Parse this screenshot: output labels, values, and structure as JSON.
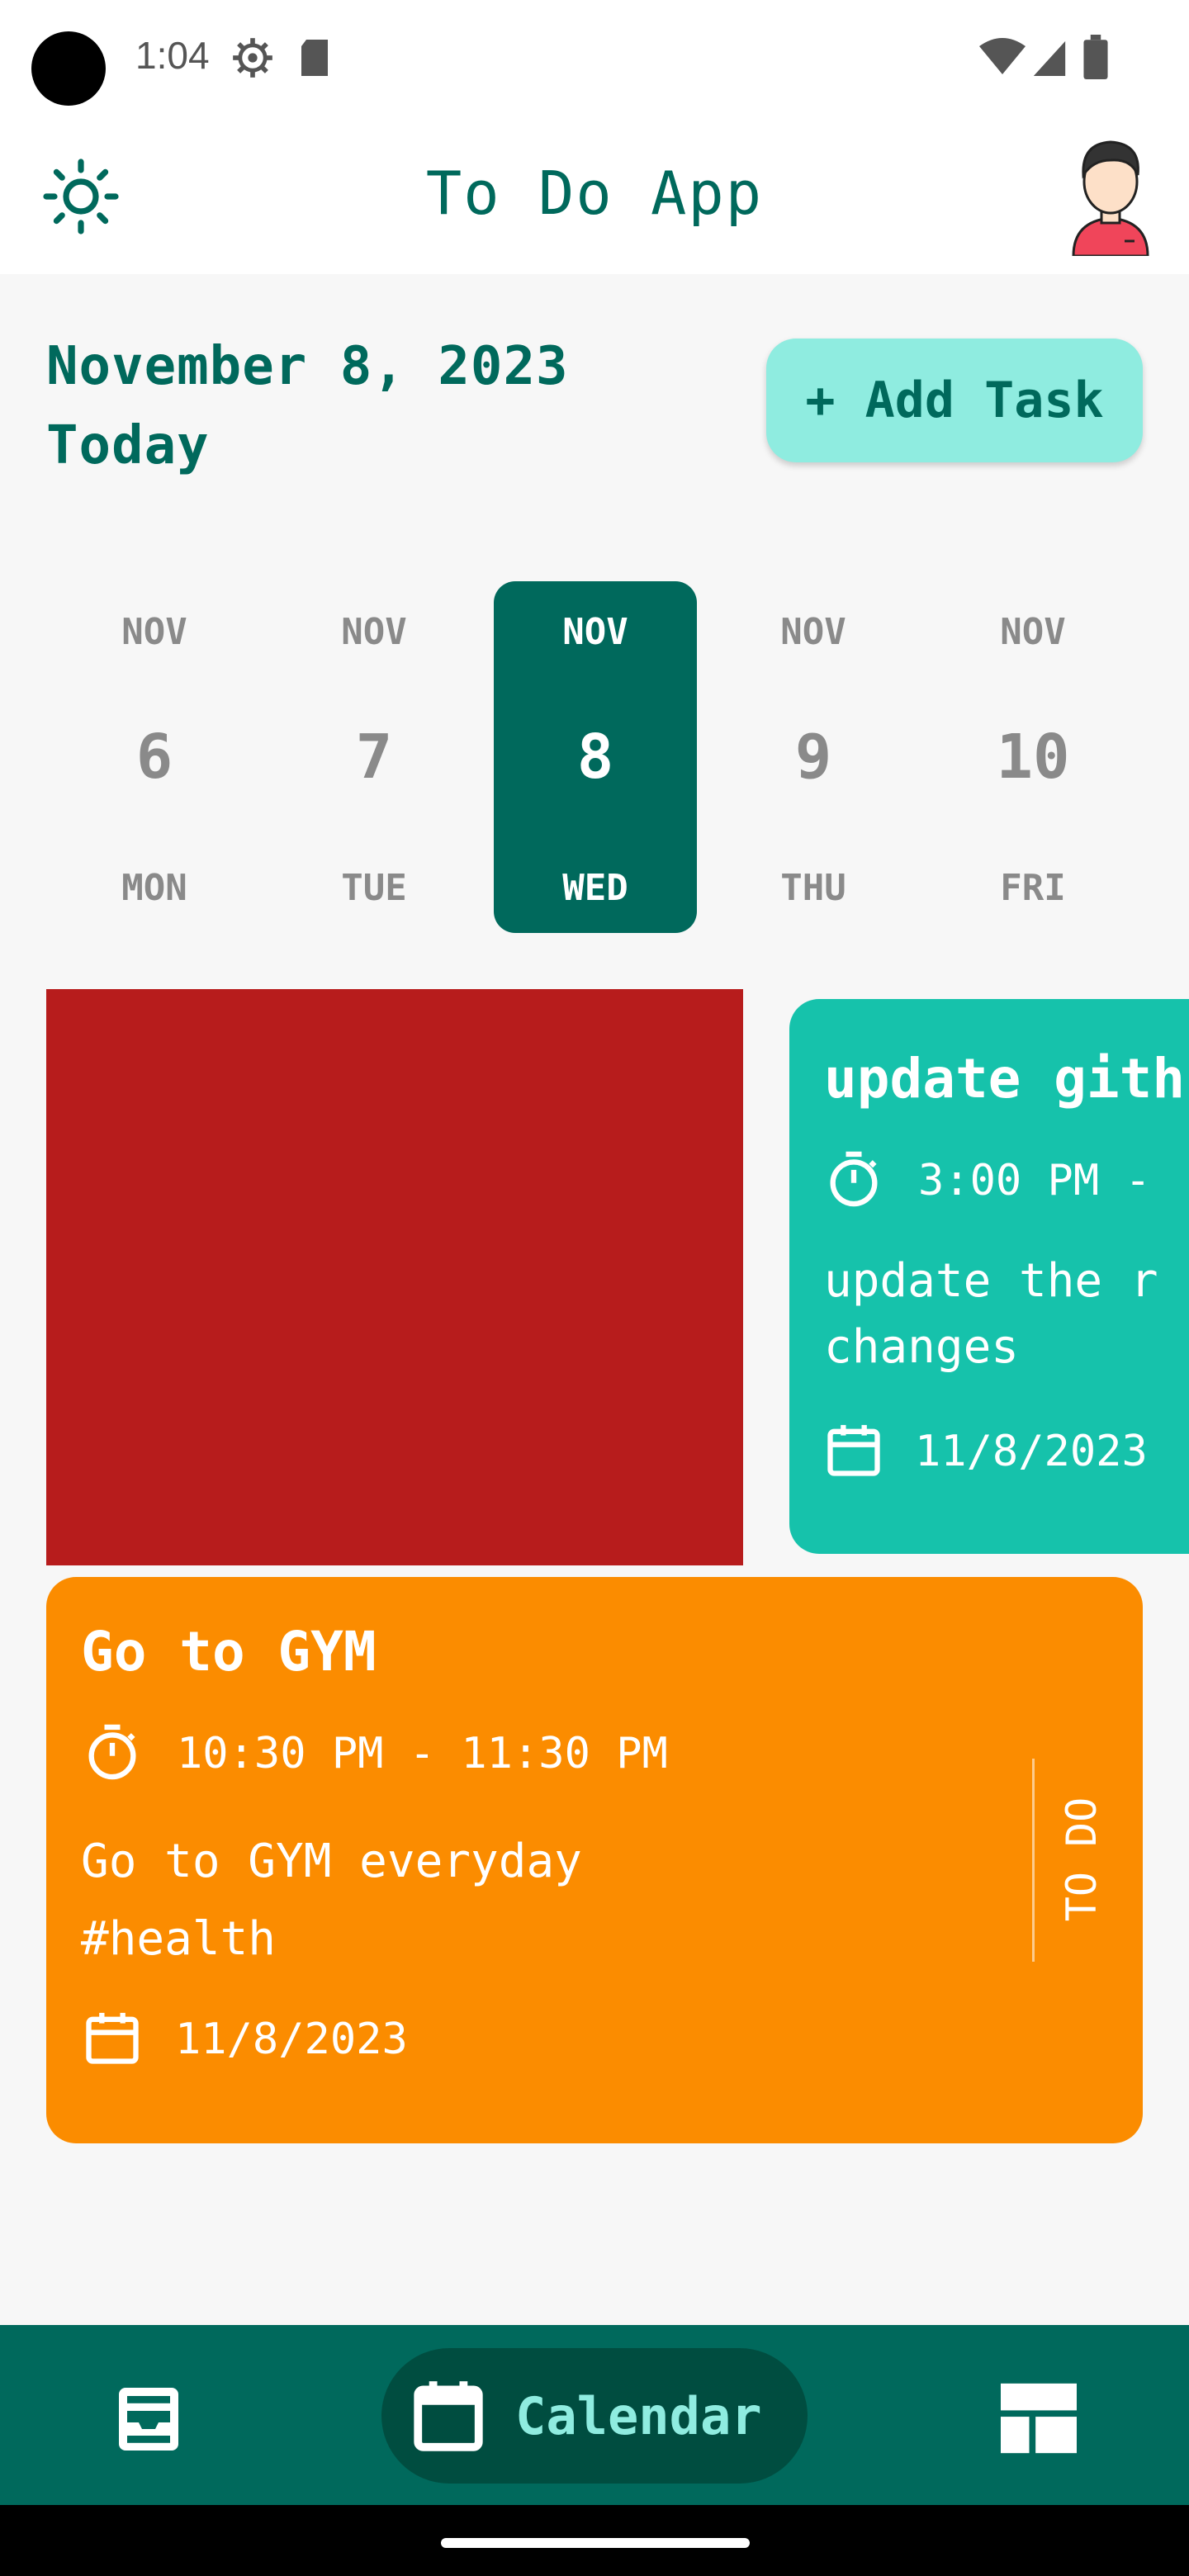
{
  "status_bar": {
    "time": "1:04",
    "icons": [
      "settings-icon",
      "sd-card-icon",
      "wifi-icon",
      "signal-icon",
      "battery-icon"
    ]
  },
  "app_bar": {
    "title": "To Do App",
    "left_icon": "sun-icon",
    "right_icon": "avatar"
  },
  "header": {
    "date": "November 8, 2023",
    "subtitle": "Today",
    "add_button": "+ Add Task"
  },
  "calendar_strip": {
    "days": [
      {
        "month": "NOV",
        "date": "6",
        "weekday": "MON",
        "selected": false
      },
      {
        "month": "NOV",
        "date": "7",
        "weekday": "TUE",
        "selected": false
      },
      {
        "month": "NOV",
        "date": "8",
        "weekday": "WED",
        "selected": true
      },
      {
        "month": "NOV",
        "date": "9",
        "weekday": "THU",
        "selected": false
      },
      {
        "month": "NOV",
        "date": "10",
        "weekday": "FRI",
        "selected": false
      }
    ]
  },
  "tasks": [
    {
      "title": "update gith",
      "time": "3:00 PM -",
      "description": "update the r\nchanges",
      "date": "11/8/2023",
      "color": "#16c2ab"
    },
    {
      "title": "Go to GYM",
      "time": "10:30 PM - 11:30 PM",
      "description": "Go to GYM everyday\n#health",
      "date": "11/8/2023",
      "status": "TO DO",
      "color": "#fb8c00"
    }
  ],
  "colors": {
    "primary": "#00695c",
    "accent": "#8fece0",
    "red": "#b71c1c"
  },
  "bottom_nav": {
    "items": [
      {
        "icon": "inbox-icon"
      },
      {
        "icon": "calendar-icon",
        "label": "Calendar",
        "active": true
      },
      {
        "icon": "dashboard-icon"
      }
    ]
  }
}
